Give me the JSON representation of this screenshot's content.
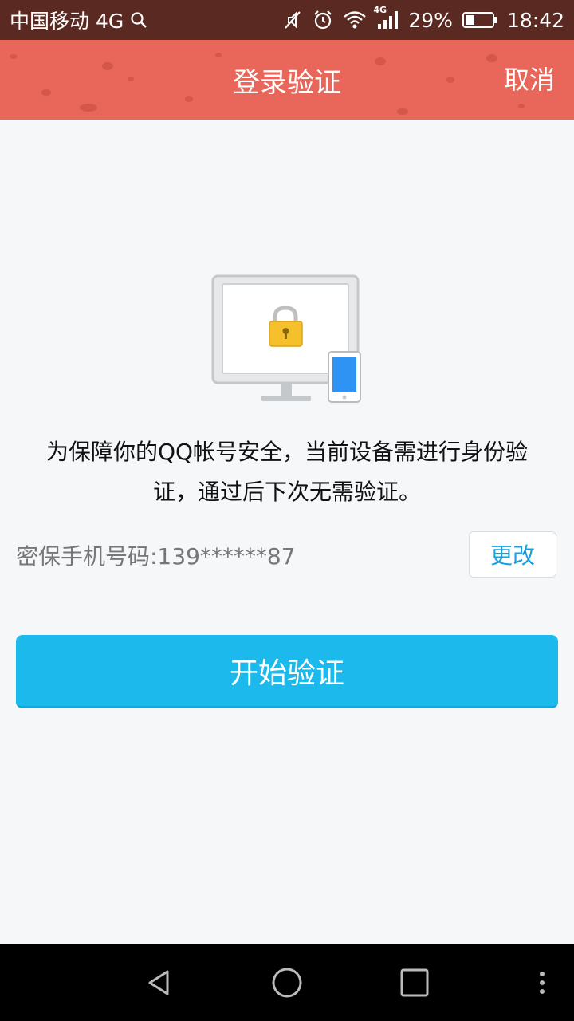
{
  "status_bar": {
    "carrier": "中国移动 4G",
    "network_badge": "4G",
    "battery": "29%",
    "time": "18:42",
    "icons": [
      "search-icon",
      "mute-icon",
      "alarm-icon",
      "wifi-icon",
      "signal-icon",
      "battery-icon"
    ]
  },
  "header": {
    "title": "登录验证",
    "cancel_label": "取消"
  },
  "main": {
    "illustration_icons": [
      "monitor-icon",
      "lock-icon",
      "phone-icon"
    ],
    "message_line1": "为保障你的QQ帐号安全，当前设备需进行身份验",
    "message_line2": "证，通过后下次无需验证。",
    "phone_label": "密保手机号码:139******87",
    "change_label": "更改",
    "start_label": "开始验证"
  },
  "nav_bar": {
    "icons": [
      "back-icon",
      "home-icon",
      "recents-icon",
      "more-icon"
    ]
  },
  "colors": {
    "header_bg": "#e8665a",
    "status_bg": "#5a2a22",
    "primary_button": "#1cb9ec",
    "link_blue": "#16a0e0",
    "page_bg": "#f5f7f9"
  }
}
